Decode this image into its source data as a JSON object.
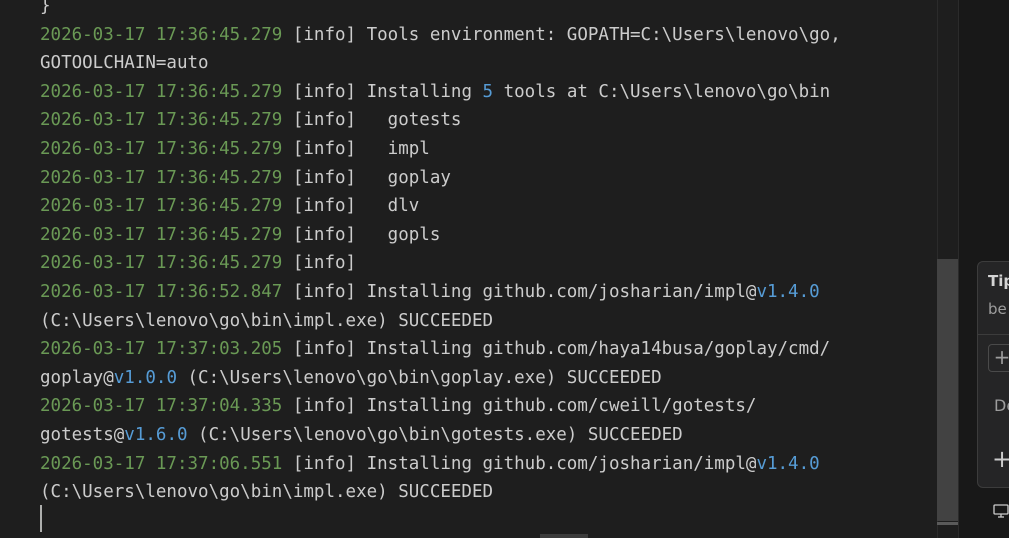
{
  "output": {
    "lines": [
      [
        {
          "t": "}",
          "c": "txt"
        }
      ],
      [
        {
          "t": "2026-03-17 17:36:45.279",
          "c": "ts"
        },
        {
          "t": " [info] Tools environment: GOPATH=C:\\Users\\lenovo\\go,",
          "c": "txt"
        }
      ],
      [
        {
          "t": "GOTOOLCHAIN=auto",
          "c": "txt"
        }
      ],
      [
        {
          "t": "2026-03-17 17:36:45.279",
          "c": "ts"
        },
        {
          "t": " [info] Installing ",
          "c": "txt"
        },
        {
          "t": "5",
          "c": "num"
        },
        {
          "t": " tools at C:\\Users\\lenovo\\go\\bin",
          "c": "txt"
        }
      ],
      [
        {
          "t": "2026-03-17 17:36:45.279",
          "c": "ts"
        },
        {
          "t": " [info]   gotests",
          "c": "txt"
        }
      ],
      [
        {
          "t": "2026-03-17 17:36:45.279",
          "c": "ts"
        },
        {
          "t": " [info]   impl",
          "c": "txt"
        }
      ],
      [
        {
          "t": "2026-03-17 17:36:45.279",
          "c": "ts"
        },
        {
          "t": " [info]   goplay",
          "c": "txt"
        }
      ],
      [
        {
          "t": "2026-03-17 17:36:45.279",
          "c": "ts"
        },
        {
          "t": " [info]   dlv",
          "c": "txt"
        }
      ],
      [
        {
          "t": "2026-03-17 17:36:45.279",
          "c": "ts"
        },
        {
          "t": " [info]   gopls",
          "c": "txt"
        }
      ],
      [
        {
          "t": "2026-03-17 17:36:45.279",
          "c": "ts"
        },
        {
          "t": " [info]",
          "c": "txt"
        }
      ],
      [
        {
          "t": "2026-03-17 17:36:52.847",
          "c": "ts"
        },
        {
          "t": " [info] Installing github.com/josharian/impl@",
          "c": "txt"
        },
        {
          "t": "v1.4.0",
          "c": "ver"
        }
      ],
      [
        {
          "t": "(C:\\Users\\lenovo\\go\\bin\\impl.exe) SUCCEEDED",
          "c": "txt"
        }
      ],
      [
        {
          "t": "2026-03-17 17:37:03.205",
          "c": "ts"
        },
        {
          "t": " [info] Installing github.com/haya14busa/goplay/cmd/",
          "c": "txt"
        }
      ],
      [
        {
          "t": "goplay@",
          "c": "txt"
        },
        {
          "t": "v1.0.0",
          "c": "ver"
        },
        {
          "t": " (C:\\Users\\lenovo\\go\\bin\\goplay.exe) SUCCEEDED",
          "c": "txt"
        }
      ],
      [
        {
          "t": "2026-03-17 17:37:04.335",
          "c": "ts"
        },
        {
          "t": " [info] Installing github.com/cweill/gotests/",
          "c": "txt"
        }
      ],
      [
        {
          "t": "gotests@",
          "c": "txt"
        },
        {
          "t": "v1.6.0",
          "c": "ver"
        },
        {
          "t": " (C:\\Users\\lenovo\\go\\bin\\gotests.exe) SUCCEEDED",
          "c": "txt"
        }
      ],
      [
        {
          "t": "2026-03-17 17:37:06.551",
          "c": "ts"
        },
        {
          "t": " [info] Installing github.com/josharian/impl@",
          "c": "txt"
        },
        {
          "t": "v1.4.0",
          "c": "ver"
        }
      ],
      [
        {
          "t": "(C:\\Users\\lenovo\\go\\bin\\impl.exe) SUCCEEDED",
          "c": "txt"
        }
      ]
    ],
    "colors": {
      "timestamp": "#6a9955",
      "number": "#569cd6",
      "text": "#cccccc",
      "background": "#1e1e1e"
    }
  },
  "side_panel": {
    "tip_title": "Tip",
    "tip_subtitle": "be",
    "add_box_label": "+",
    "item_label": "De",
    "add_label": "+",
    "monitor_icon": "monitor-icon"
  }
}
